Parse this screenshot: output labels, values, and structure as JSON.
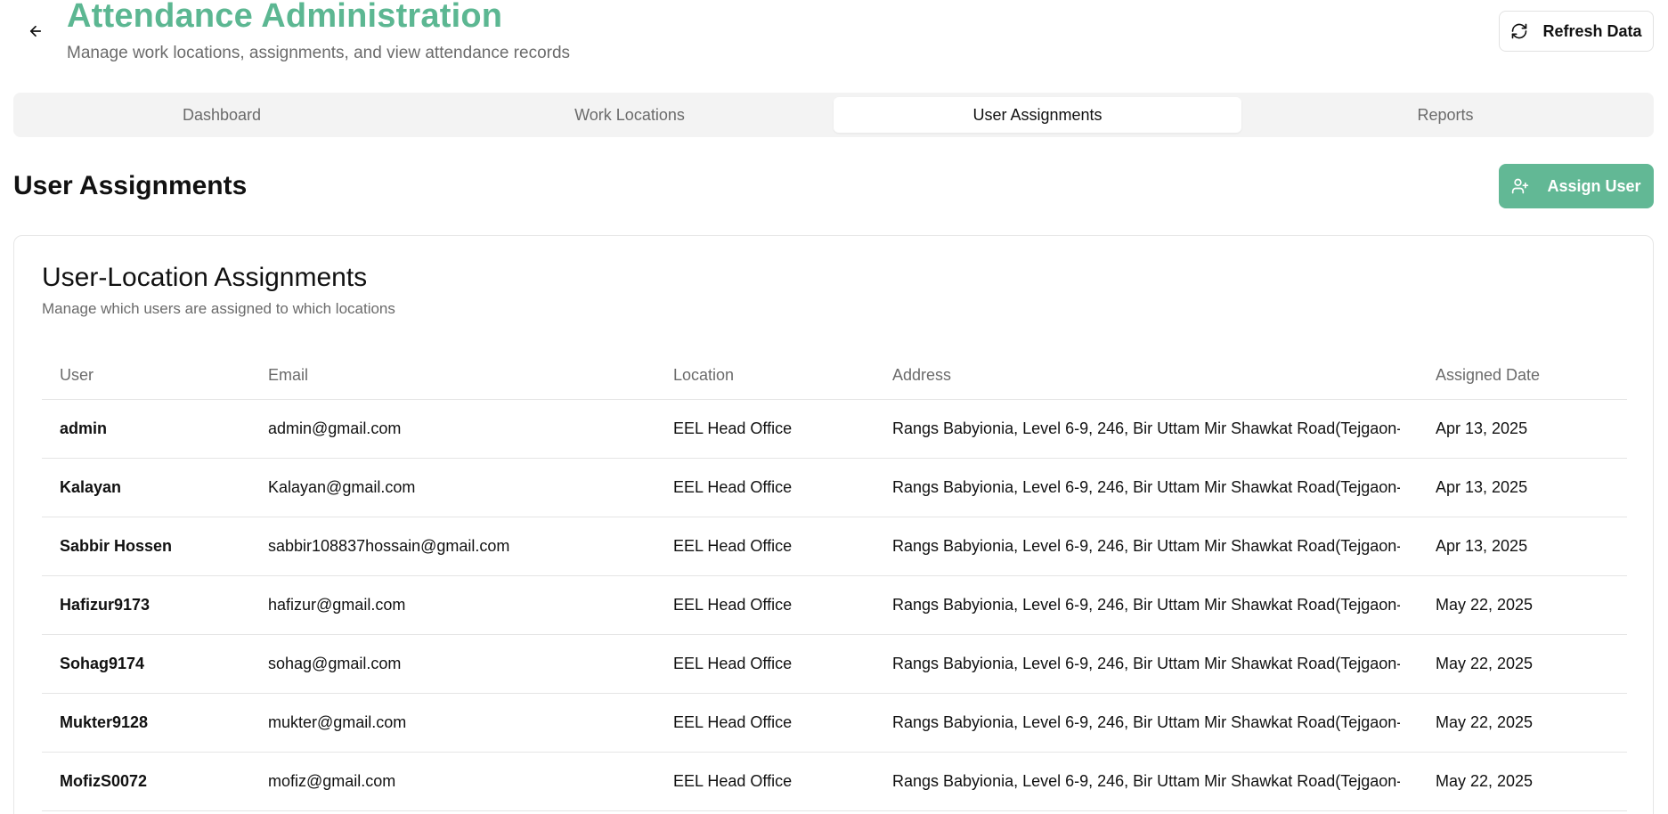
{
  "header": {
    "title": "Attendance Administration",
    "subtitle": "Manage work locations, assignments, and view attendance records",
    "refresh_label": "Refresh Data"
  },
  "tabs": [
    {
      "label": "Dashboard",
      "active": false
    },
    {
      "label": "Work Locations",
      "active": false
    },
    {
      "label": "User Assignments",
      "active": true
    },
    {
      "label": "Reports",
      "active": false
    }
  ],
  "section": {
    "title": "User Assignments",
    "assign_label": "Assign User"
  },
  "card": {
    "title": "User-Location Assignments",
    "subtitle": "Manage which users are assigned to which locations"
  },
  "table": {
    "columns": [
      "User",
      "Email",
      "Location",
      "Address",
      "Assigned Date"
    ],
    "rows": [
      {
        "user": "admin",
        "email": "admin@gmail.com",
        "location": "EEL Head Office",
        "address": "Rangs Babyionia, Level 6-9, 246, Bir Uttam Mir Shawkat Road(Tejgaon-G...",
        "date": "Apr 13, 2025"
      },
      {
        "user": "Kalayan",
        "email": "Kalayan@gmail.com",
        "location": "EEL Head Office",
        "address": "Rangs Babyionia, Level 6-9, 246, Bir Uttam Mir Shawkat Road(Tejgaon-G...",
        "date": "Apr 13, 2025"
      },
      {
        "user": "Sabbir Hossen",
        "email": "sabbir108837hossain@gmail.com",
        "location": "EEL Head Office",
        "address": "Rangs Babyionia, Level 6-9, 246, Bir Uttam Mir Shawkat Road(Tejgaon-G...",
        "date": "Apr 13, 2025"
      },
      {
        "user": "Hafizur9173",
        "email": "hafizur@gmail.com",
        "location": "EEL Head Office",
        "address": "Rangs Babyionia, Level 6-9, 246, Bir Uttam Mir Shawkat Road(Tejgaon-G...",
        "date": "May 22, 2025"
      },
      {
        "user": "Sohag9174",
        "email": "sohag@gmail.com",
        "location": "EEL Head Office",
        "address": "Rangs Babyionia, Level 6-9, 246, Bir Uttam Mir Shawkat Road(Tejgaon-G...",
        "date": "May 22, 2025"
      },
      {
        "user": "Mukter9128",
        "email": "mukter@gmail.com",
        "location": "EEL Head Office",
        "address": "Rangs Babyionia, Level 6-9, 246, Bir Uttam Mir Shawkat Road(Tejgaon-G...",
        "date": "May 22, 2025"
      },
      {
        "user": "MofizS0072",
        "email": "mofiz@gmail.com",
        "location": "EEL Head Office",
        "address": "Rangs Babyionia, Level 6-9, 246, Bir Uttam Mir Shawkat Road(Tejgaon-G...",
        "date": "May 22, 2025"
      }
    ]
  },
  "icons": {
    "back": "arrow-left-icon",
    "refresh": "refresh-icon",
    "assign": "user-plus-icon"
  },
  "colors": {
    "accent": "#5cb792",
    "button": "#62b895"
  }
}
